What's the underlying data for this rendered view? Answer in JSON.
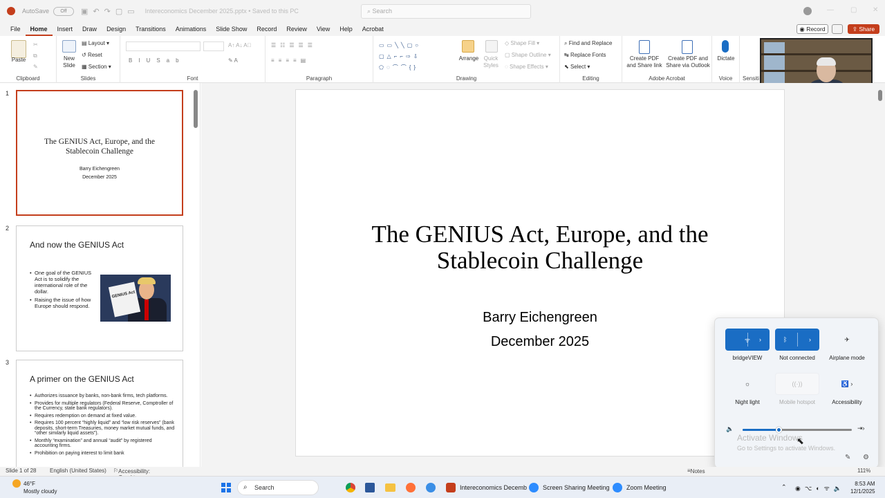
{
  "titlebar": {
    "autosave_label": "AutoSave",
    "autosave_state": "Off",
    "doc_title": "Intereconomics December 2025.pptx • Saved to this PC",
    "search_placeholder": "Search"
  },
  "menubar": {
    "tabs": [
      "File",
      "Home",
      "Insert",
      "Draw",
      "Design",
      "Transitions",
      "Animations",
      "Slide Show",
      "Record",
      "Review",
      "View",
      "Help",
      "Acrobat"
    ],
    "active_tab": "Home",
    "record_label": "Record",
    "share_label": "Share"
  },
  "ribbon": {
    "clipboard": {
      "label": "Clipboard",
      "paste": "Paste"
    },
    "slides": {
      "label": "Slides",
      "new_slide": "New\nSlide",
      "layout": "Layout",
      "reset": "Reset",
      "section": "Section"
    },
    "font": {
      "label": "Font"
    },
    "paragraph": {
      "label": "Paragraph"
    },
    "drawing": {
      "label": "Drawing",
      "arrange": "Arrange",
      "quick_styles": "Quick\nStyles",
      "shape_fill": "Shape Fill",
      "shape_outline": "Shape Outline",
      "shape_effects": "Shape Effects"
    },
    "editing": {
      "label": "Editing",
      "find_replace": "Find and Replace",
      "replace_fonts": "Replace Fonts",
      "select": "Select"
    },
    "acrobat": {
      "label": "Adobe Acrobat",
      "create_share": "Create PDF\nand Share link",
      "create_outlook": "Create PDF and\nShare via Outlook"
    },
    "voice": {
      "label": "Voice",
      "dictate": "Dictate"
    },
    "sensitivity": {
      "label": "Sensiti"
    }
  },
  "thumbnails": {
    "numbers": [
      "1",
      "2",
      "3"
    ],
    "slide1": {
      "title": "The GENIUS Act, Europe, and the Stablecoin Challenge",
      "author": "Barry Eichengreen",
      "date": "December 2025"
    },
    "slide2": {
      "title": "And now the GENIUS Act",
      "bullets": [
        "One goal of the GENIUS Act is to solidify the international role of the dollar.",
        "Raising the issue of how Europe should respond."
      ],
      "image_sign": "GENIUS Act"
    },
    "slide3": {
      "title": "A primer on the GENIUS Act",
      "bullets": [
        "Authorizes issuance by banks, non-bank firms, tech platforms.",
        "Provides for multiple regulators (Federal Reserve, Comptroller of the Currency, state bank regulators).",
        "Requires redemption on demand at fixed value.",
        "Requires 100 percent “highly liquid” and “low risk reserves” (bank deposits, short-term Treasuries, money market mutual funds, and “other similarly liquid assets”).",
        "Monthly “examination” and annual “audit” by registered accounting firms.",
        "Prohibition on paying interest to limit bank"
      ]
    }
  },
  "slide": {
    "title": "The GENIUS Act, Europe, and the Stablecoin Challenge",
    "author": "Barry Eichengreen",
    "date": "December 2025"
  },
  "quick_settings": {
    "tiles": [
      {
        "label": "bridgeVIEW",
        "state": "on",
        "icon": "wifi-icon"
      },
      {
        "label": "Not connected",
        "state": "on",
        "icon": "bluetooth-icon"
      },
      {
        "label": "Airplane mode",
        "state": "off",
        "icon": "airplane-icon"
      },
      {
        "label": "Night light",
        "state": "off",
        "icon": "brightness-icon"
      },
      {
        "label": "Mobile hotspot",
        "state": "disabled",
        "icon": "hotspot-icon"
      },
      {
        "label": "Accessibility",
        "state": "off",
        "icon": "accessibility-icon"
      }
    ],
    "volume_level": 0.33
  },
  "watermark": {
    "title": "Activate Windows",
    "subtitle": "Go to Settings to activate Windows."
  },
  "statusbar": {
    "slide_count": "Slide 1 of 28",
    "language": "English (United States)",
    "accessibility": "Accessibility: Good to go",
    "notes": "Notes",
    "zoom": "111%"
  },
  "taskbar": {
    "weather_temp": "46°F",
    "weather_desc": "Mostly cloudy",
    "search": "Search",
    "apps": [
      "Intereconomics Decemb",
      "Screen Sharing Meeting",
      "Zoom Meeting"
    ],
    "time": "8:53 AM",
    "date": "12/1/2025"
  },
  "colors": {
    "accent": "#c43e1c",
    "toggle_on": "#1a6dc4"
  }
}
